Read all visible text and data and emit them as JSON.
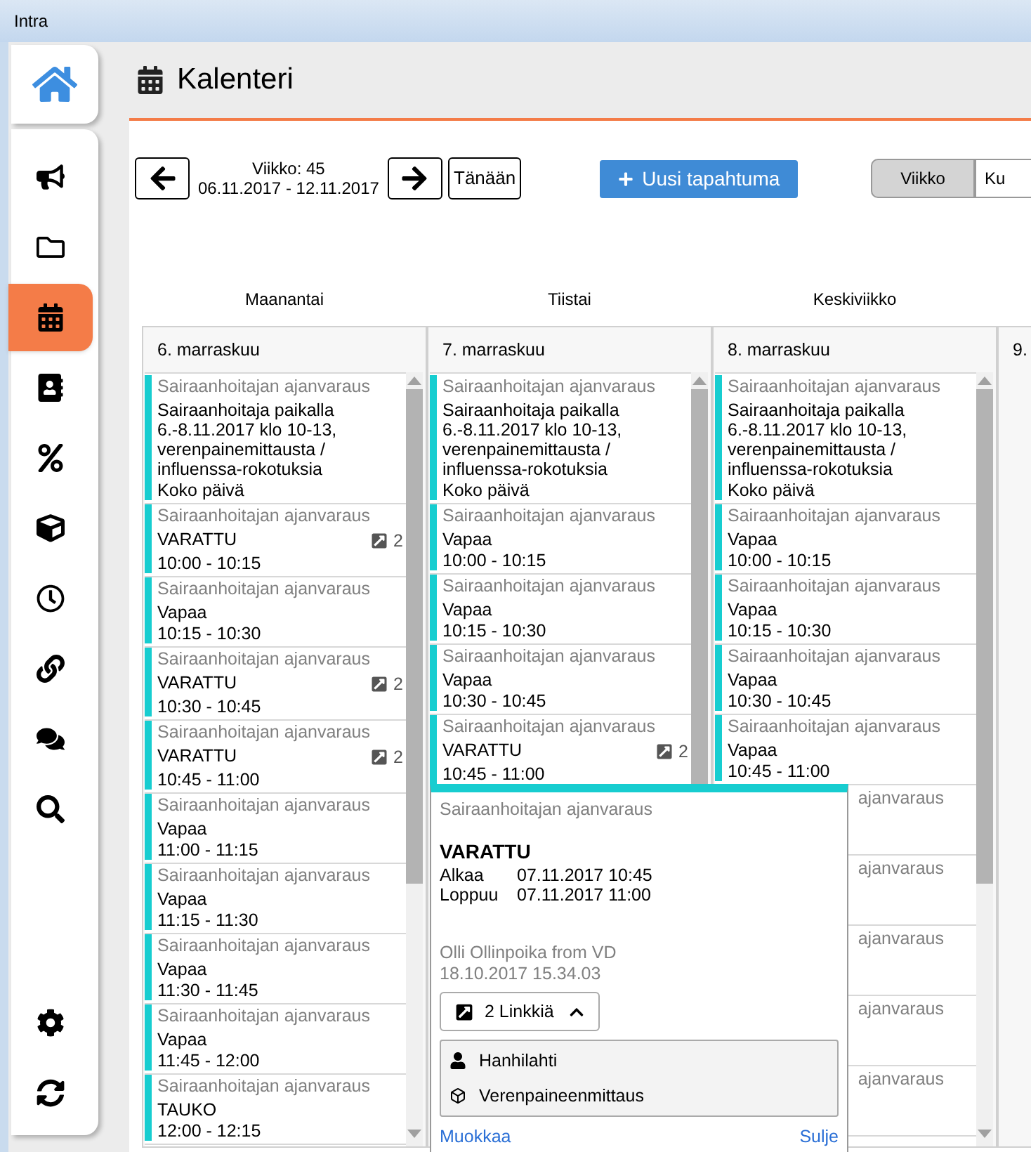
{
  "window": {
    "title": "Intra"
  },
  "sidebar": {
    "items": [
      {
        "kind": "megaphone",
        "selected": false
      },
      {
        "kind": "folder",
        "selected": false
      },
      {
        "kind": "calendar",
        "selected": true
      },
      {
        "kind": "contacts",
        "selected": false
      },
      {
        "kind": "percent",
        "selected": false
      },
      {
        "kind": "cube",
        "selected": false
      },
      {
        "kind": "clock",
        "selected": false
      },
      {
        "kind": "link",
        "selected": false
      },
      {
        "kind": "chat",
        "selected": false
      },
      {
        "kind": "search",
        "selected": false
      }
    ],
    "bottom_items": [
      {
        "kind": "settings",
        "selected": false
      },
      {
        "kind": "sync",
        "selected": false
      }
    ]
  },
  "page": {
    "title": "Kalenteri"
  },
  "toolbar": {
    "week_label": "Viikko: 45",
    "date_range": "06.11.2017 - 12.11.2017",
    "today_button": "Tänään",
    "new_event_button": "Uusi tapahtuma",
    "views": [
      {
        "label": "Viikko",
        "selected": true
      },
      {
        "label": "Ku",
        "selected": false
      }
    ]
  },
  "day_names": [
    "Maanantai",
    "Tiistai",
    "Keskiviikko"
  ],
  "columns": [
    {
      "date": "6. marraskuu",
      "events": [
        {
          "kind": "event",
          "title": "Sairaanhoitajan ajanvaraus",
          "text": "Sairaanhoitaja paikalla 6.-8.11.2017 klo 10-13, verenpainemittausta / influenssa-rokotuksia",
          "time": "Koko päivä"
        },
        {
          "kind": "event",
          "title": "Sairaanhoitajan ajanvaraus",
          "text": "VARATTU",
          "time": "10:00 - 10:15",
          "links": "2"
        },
        {
          "kind": "event",
          "title": "Sairaanhoitajan ajanvaraus",
          "text": "Vapaa",
          "time": "10:15 - 10:30"
        },
        {
          "kind": "event",
          "title": "Sairaanhoitajan ajanvaraus",
          "text": "VARATTU",
          "time": "10:30 - 10:45",
          "links": "2"
        },
        {
          "kind": "event",
          "title": "Sairaanhoitajan ajanvaraus",
          "text": "VARATTU",
          "time": "10:45 - 11:00",
          "links": "2"
        },
        {
          "kind": "event",
          "title": "Sairaanhoitajan ajanvaraus",
          "text": "Vapaa",
          "time": "11:00 - 11:15"
        },
        {
          "kind": "event",
          "title": "Sairaanhoitajan ajanvaraus",
          "text": "Vapaa",
          "time": "11:15 - 11:30"
        },
        {
          "kind": "event",
          "title": "Sairaanhoitajan ajanvaraus",
          "text": "Vapaa",
          "time": "11:30 - 11:45"
        },
        {
          "kind": "event",
          "title": "Sairaanhoitajan ajanvaraus",
          "text": "Vapaa",
          "time": "11:45 - 12:00"
        },
        {
          "kind": "event",
          "title": "Sairaanhoitajan ajanvaraus",
          "text": "TAUKO",
          "time": "12:00 - 12:15"
        }
      ]
    },
    {
      "date": "7. marraskuu",
      "events": [
        {
          "kind": "event",
          "title": "Sairaanhoitajan ajanvaraus",
          "text": "Sairaanhoitaja paikalla 6.-8.11.2017 klo 10-13, verenpainemittausta / influenssa-rokotuksia",
          "time": "Koko päivä"
        },
        {
          "kind": "event",
          "title": "Sairaanhoitajan ajanvaraus",
          "text": "Vapaa",
          "time": "10:00 - 10:15"
        },
        {
          "kind": "event",
          "title": "Sairaanhoitajan ajanvaraus",
          "text": "Vapaa",
          "time": "10:15 - 10:30"
        },
        {
          "kind": "event",
          "title": "Sairaanhoitajan ajanvaraus",
          "text": "Vapaa",
          "time": "10:30 - 10:45"
        },
        {
          "kind": "event",
          "title": "Sairaanhoitajan ajanvaraus",
          "text": "VARATTU",
          "time": "10:45 - 11:00",
          "links": "2"
        }
      ]
    },
    {
      "date": "8. marraskuu",
      "events": [
        {
          "kind": "event",
          "title": "Sairaanhoitajan ajanvaraus",
          "text": "Sairaanhoitaja paikalla 6.-8.11.2017 klo 10-13, verenpainemittausta / influenssa-rokotuksia",
          "time": "Koko päivä"
        },
        {
          "kind": "event",
          "title": "Sairaanhoitajan ajanvaraus",
          "text": "Vapaa",
          "time": "10:00 - 10:15"
        },
        {
          "kind": "event",
          "title": "Sairaanhoitajan ajanvaraus",
          "text": "Vapaa",
          "time": "10:15 - 10:30"
        },
        {
          "kind": "event",
          "title": "Sairaanhoitajan ajanvaraus",
          "text": "Vapaa",
          "time": "10:30 - 10:45"
        },
        {
          "kind": "event",
          "title": "Sairaanhoitajan ajanvaraus",
          "text": "Vapaa",
          "time": "10:45 - 11:00"
        },
        {
          "kind": "partial",
          "title": "ajanvaraus"
        },
        {
          "kind": "partial",
          "title": "ajanvaraus"
        },
        {
          "kind": "partial",
          "title": "ajanvaraus"
        },
        {
          "kind": "partial",
          "title": "ajanvaraus"
        },
        {
          "kind": "partial",
          "title": "ajanvaraus"
        }
      ]
    },
    {
      "date": "9."
    }
  ],
  "popup": {
    "category": "Sairaanhoitajan ajanvaraus",
    "status": "VARATTU",
    "fields": [
      {
        "label": "Alkaa",
        "value": "07.11.2017 10:45"
      },
      {
        "label": "Loppuu",
        "value": "07.11.2017 11:00"
      }
    ],
    "creator": "Olli Ollinpoika from VD",
    "created": "18.10.2017 15.34.03",
    "links_button": "2 Linkkiä",
    "expanded": true,
    "links": [
      {
        "kind": "person",
        "label": "Hanhilahti"
      },
      {
        "kind": "item",
        "label": "Verenpaineenmittaus"
      }
    ],
    "edit_link": "Muokkaa",
    "close_link": "Sulje"
  }
}
